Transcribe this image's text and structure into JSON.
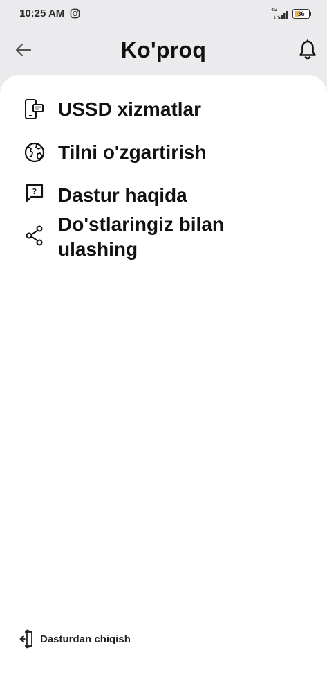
{
  "status_bar": {
    "time": "10:25 AM",
    "network": "4G",
    "battery_level": "36",
    "battery_fraction": 0.36,
    "icons": [
      "instagram-icon",
      "signal-icon",
      "battery-icon"
    ]
  },
  "header": {
    "title": "Ko'proq",
    "back_icon": "arrow-left-icon",
    "notification_icon": "bell-icon"
  },
  "menu": {
    "items": [
      {
        "label": "USSD xizmatlar",
        "icon": "phone-message-icon"
      },
      {
        "label": "Tilni o'zgartirish",
        "icon": "globe-icon"
      },
      {
        "label": "Dastur haqida",
        "icon": "question-chat-icon"
      },
      {
        "label": "Do'stlaringiz bilan ulashing",
        "icon": "share-icon"
      }
    ]
  },
  "footer": {
    "logout_label": "Dasturdan chiqish",
    "logout_icon": "logout-icon"
  },
  "colors": {
    "background": "#ebebed",
    "sheet": "#ffffff",
    "text": "#111111",
    "battery": "#e9b54c"
  }
}
